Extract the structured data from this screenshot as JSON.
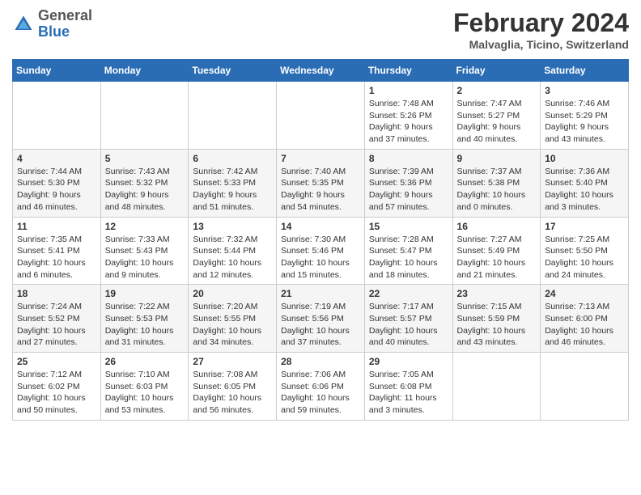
{
  "header": {
    "logo_general": "General",
    "logo_blue": "Blue",
    "month_title": "February 2024",
    "location": "Malvaglia, Ticino, Switzerland"
  },
  "days_of_week": [
    "Sunday",
    "Monday",
    "Tuesday",
    "Wednesday",
    "Thursday",
    "Friday",
    "Saturday"
  ],
  "weeks": [
    [
      {
        "day": "",
        "info": ""
      },
      {
        "day": "",
        "info": ""
      },
      {
        "day": "",
        "info": ""
      },
      {
        "day": "",
        "info": ""
      },
      {
        "day": "1",
        "info": "Sunrise: 7:48 AM\nSunset: 5:26 PM\nDaylight: 9 hours and 37 minutes."
      },
      {
        "day": "2",
        "info": "Sunrise: 7:47 AM\nSunset: 5:27 PM\nDaylight: 9 hours and 40 minutes."
      },
      {
        "day": "3",
        "info": "Sunrise: 7:46 AM\nSunset: 5:29 PM\nDaylight: 9 hours and 43 minutes."
      }
    ],
    [
      {
        "day": "4",
        "info": "Sunrise: 7:44 AM\nSunset: 5:30 PM\nDaylight: 9 hours and 46 minutes."
      },
      {
        "day": "5",
        "info": "Sunrise: 7:43 AM\nSunset: 5:32 PM\nDaylight: 9 hours and 48 minutes."
      },
      {
        "day": "6",
        "info": "Sunrise: 7:42 AM\nSunset: 5:33 PM\nDaylight: 9 hours and 51 minutes."
      },
      {
        "day": "7",
        "info": "Sunrise: 7:40 AM\nSunset: 5:35 PM\nDaylight: 9 hours and 54 minutes."
      },
      {
        "day": "8",
        "info": "Sunrise: 7:39 AM\nSunset: 5:36 PM\nDaylight: 9 hours and 57 minutes."
      },
      {
        "day": "9",
        "info": "Sunrise: 7:37 AM\nSunset: 5:38 PM\nDaylight: 10 hours and 0 minutes."
      },
      {
        "day": "10",
        "info": "Sunrise: 7:36 AM\nSunset: 5:40 PM\nDaylight: 10 hours and 3 minutes."
      }
    ],
    [
      {
        "day": "11",
        "info": "Sunrise: 7:35 AM\nSunset: 5:41 PM\nDaylight: 10 hours and 6 minutes."
      },
      {
        "day": "12",
        "info": "Sunrise: 7:33 AM\nSunset: 5:43 PM\nDaylight: 10 hours and 9 minutes."
      },
      {
        "day": "13",
        "info": "Sunrise: 7:32 AM\nSunset: 5:44 PM\nDaylight: 10 hours and 12 minutes."
      },
      {
        "day": "14",
        "info": "Sunrise: 7:30 AM\nSunset: 5:46 PM\nDaylight: 10 hours and 15 minutes."
      },
      {
        "day": "15",
        "info": "Sunrise: 7:28 AM\nSunset: 5:47 PM\nDaylight: 10 hours and 18 minutes."
      },
      {
        "day": "16",
        "info": "Sunrise: 7:27 AM\nSunset: 5:49 PM\nDaylight: 10 hours and 21 minutes."
      },
      {
        "day": "17",
        "info": "Sunrise: 7:25 AM\nSunset: 5:50 PM\nDaylight: 10 hours and 24 minutes."
      }
    ],
    [
      {
        "day": "18",
        "info": "Sunrise: 7:24 AM\nSunset: 5:52 PM\nDaylight: 10 hours and 27 minutes."
      },
      {
        "day": "19",
        "info": "Sunrise: 7:22 AM\nSunset: 5:53 PM\nDaylight: 10 hours and 31 minutes."
      },
      {
        "day": "20",
        "info": "Sunrise: 7:20 AM\nSunset: 5:55 PM\nDaylight: 10 hours and 34 minutes."
      },
      {
        "day": "21",
        "info": "Sunrise: 7:19 AM\nSunset: 5:56 PM\nDaylight: 10 hours and 37 minutes."
      },
      {
        "day": "22",
        "info": "Sunrise: 7:17 AM\nSunset: 5:57 PM\nDaylight: 10 hours and 40 minutes."
      },
      {
        "day": "23",
        "info": "Sunrise: 7:15 AM\nSunset: 5:59 PM\nDaylight: 10 hours and 43 minutes."
      },
      {
        "day": "24",
        "info": "Sunrise: 7:13 AM\nSunset: 6:00 PM\nDaylight: 10 hours and 46 minutes."
      }
    ],
    [
      {
        "day": "25",
        "info": "Sunrise: 7:12 AM\nSunset: 6:02 PM\nDaylight: 10 hours and 50 minutes."
      },
      {
        "day": "26",
        "info": "Sunrise: 7:10 AM\nSunset: 6:03 PM\nDaylight: 10 hours and 53 minutes."
      },
      {
        "day": "27",
        "info": "Sunrise: 7:08 AM\nSunset: 6:05 PM\nDaylight: 10 hours and 56 minutes."
      },
      {
        "day": "28",
        "info": "Sunrise: 7:06 AM\nSunset: 6:06 PM\nDaylight: 10 hours and 59 minutes."
      },
      {
        "day": "29",
        "info": "Sunrise: 7:05 AM\nSunset: 6:08 PM\nDaylight: 11 hours and 3 minutes."
      },
      {
        "day": "",
        "info": ""
      },
      {
        "day": "",
        "info": ""
      }
    ]
  ]
}
